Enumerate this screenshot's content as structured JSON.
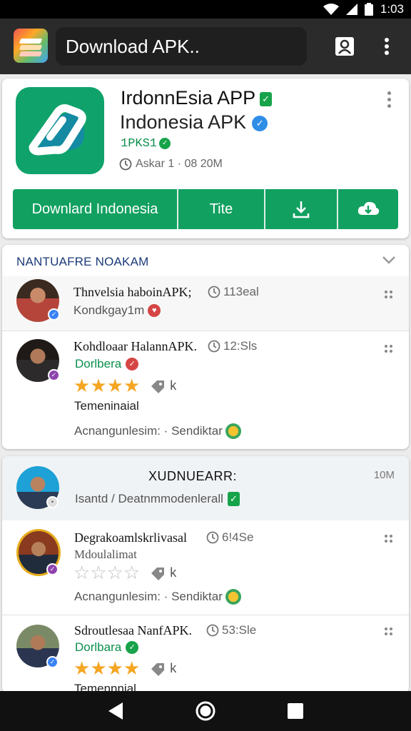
{
  "status_bar": {
    "time": "1:03"
  },
  "app_bar": {
    "title": "Download APK.."
  },
  "app_card": {
    "title_line_1": "IrdonnEsia APP",
    "title_line_2": "Indonesia APK",
    "sub_code": "1PKS1",
    "meta": "Askar 1 · 08 20M",
    "actions": [
      "Downlard Indonesia",
      "Tite"
    ]
  },
  "section1": {
    "heading": "NANTUAFRE NOAKAM",
    "rows": [
      {
        "title": "Thnvelsia haboinAPK;",
        "time": "113eal",
        "sub": "Kondkgay1m"
      },
      {
        "title": "Kohdloaar HalannAPK.",
        "time": "12:Sls",
        "sub": "Dorlbera",
        "rating_label": "k",
        "note": "Temeninaial",
        "footer": "Acnangunlesim: · Sendiktar"
      }
    ]
  },
  "section2": {
    "heading": "XUDNUEARR:",
    "right": "10M",
    "sub": "Isantd / Deatnmmodenlerall",
    "rows": [
      {
        "title": "Degrakoamlskrlivasal",
        "time": "6!4Se",
        "sub": "Mdoulalimat",
        "rating_label": "k",
        "footer": "Acnangunlesim: · Sendiktar"
      },
      {
        "title": "Sdroutlesaa NanfAPK.",
        "time": "53:Sle",
        "sub": "Dorlbara",
        "rating_label": "k",
        "note": "Temennnial"
      }
    ]
  },
  "colors": {
    "brand_green": "#11a060",
    "app_bar": "#2b2b2b",
    "star": "#f5a623",
    "heading_blue": "#1b3a7a"
  },
  "ratings": {
    "row_1_2": 4,
    "row_2_1": 0,
    "row_2_2": 4
  }
}
